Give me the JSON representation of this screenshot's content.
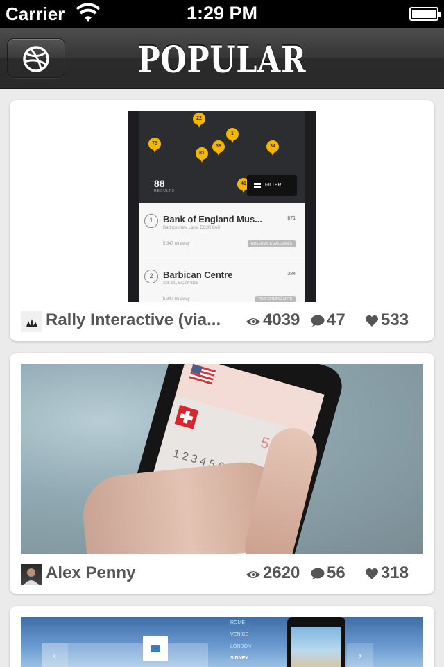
{
  "status_bar": {
    "carrier": "Carrier",
    "time": "1:29 PM"
  },
  "nav": {
    "title": "POPULAR",
    "button_icon": "dribbble-ball-icon"
  },
  "shots": [
    {
      "author": "Rally Interactive (via...",
      "views": "4039",
      "comments": "47",
      "likes": "533",
      "preview": {
        "results_count": "88",
        "results_label": "RESULTS",
        "filter_label": "FILTER",
        "pins": [
          "22",
          "75",
          "1",
          "81",
          "38",
          "34",
          "41"
        ],
        "places": [
          {
            "num": "1",
            "name": "Bank of England Mus...",
            "address": "Bartholomew Lane, EC2R 8AH",
            "distance": "5,347 mi away",
            "score": "871",
            "tag": "MUSEUMS & GALLERIES"
          },
          {
            "num": "2",
            "name": "Barbican Centre",
            "address": "Silk St., EC2Y 8DS",
            "distance": "5,347 mi away",
            "score": "384",
            "tag": "PERFORMING ARTS"
          }
        ]
      }
    },
    {
      "author": "Alex Penny",
      "views": "2620",
      "comments": "56",
      "likes": "318",
      "preview": {
        "amount": "5,000",
        "keys": "1  2  3  4  5  6  7  8  9  0"
      }
    },
    {
      "preview": {
        "cities": [
          "ROME",
          "VENICE",
          "LONDON",
          "SIDNEY"
        ]
      }
    }
  ],
  "icons": {
    "views": "eye-icon",
    "comments": "comment-bubble-icon",
    "likes": "heart-icon"
  },
  "colors": {
    "nav_bg": "#363636",
    "page_bg": "#ebebeb",
    "stat_text": "#555555",
    "pin_yellow": "#f2b705"
  }
}
